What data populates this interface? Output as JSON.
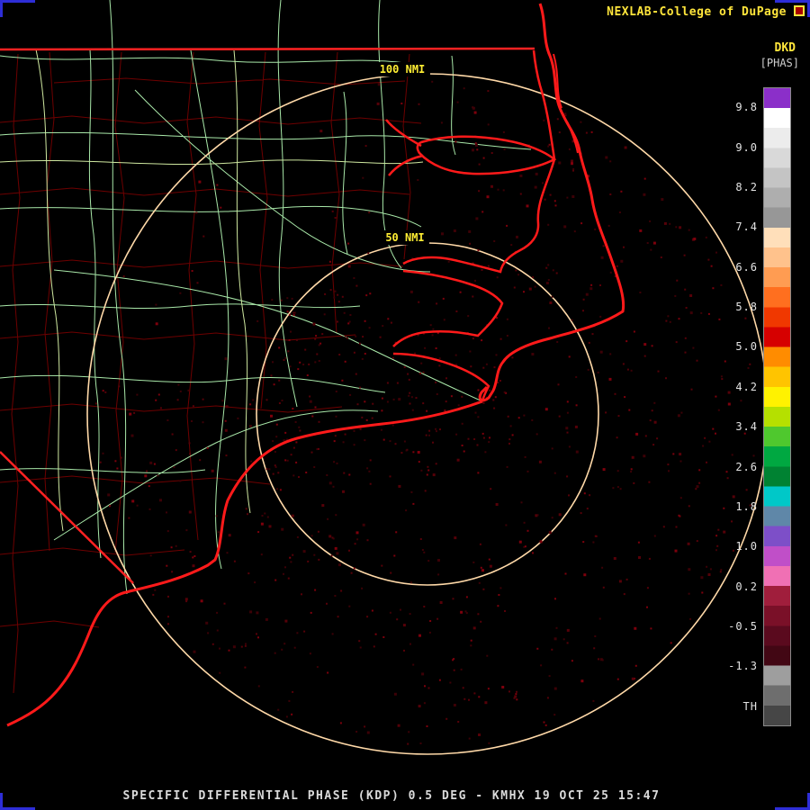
{
  "header": {
    "credit": "NEXLAB-College of DuPage"
  },
  "colorbar": {
    "product": "DKD",
    "units": "[PHAS]",
    "ticks": [
      "9.8",
      "9.0",
      "8.2",
      "7.4",
      "6.6",
      "5.8",
      "5.0",
      "4.2",
      "3.4",
      "2.6",
      "1.8",
      "1.0",
      "0.2",
      "-0.5",
      "-1.3",
      "TH"
    ],
    "segment_colors": [
      "#8b2fc9",
      "#ffffff",
      "#ececec",
      "#d9d9d9",
      "#c4c4c4",
      "#aeaeae",
      "#979797",
      "#ffdfba",
      "#ffc28c",
      "#ff9c52",
      "#ff6f1f",
      "#f03800",
      "#d60000",
      "#ff8c00",
      "#ffc400",
      "#fff200",
      "#b5e000",
      "#4fc82e",
      "#00a841",
      "#008232",
      "#00c8c8",
      "#5f87a8",
      "#7d4fc8",
      "#c04fc8",
      "#f070b4",
      "#a01e3c",
      "#7a1028",
      "#5a0a1e",
      "#420714",
      "#9e9e9e",
      "#6e6e6e",
      "#464646"
    ]
  },
  "map": {
    "range_ring_labels": [
      "100 NMI",
      "50 NMI"
    ]
  },
  "footer": {
    "caption": "SPECIFIC DIFFERENTIAL PHASE (KDP) 0.5 DEG - KMHX 19 OCT 25 15:47"
  },
  "colors": {
    "coastline": "#ff1a1a",
    "state_border": "#ff2222",
    "county_line": "#6e0000",
    "road_green": "#a9e8a9",
    "road_light": "#cfe8a0",
    "range_ring": "#ffd9a8",
    "ring_label_yellow": "#ffee33",
    "echo_dark_red": "#560008",
    "frame_blue": "#2d2dd6"
  }
}
